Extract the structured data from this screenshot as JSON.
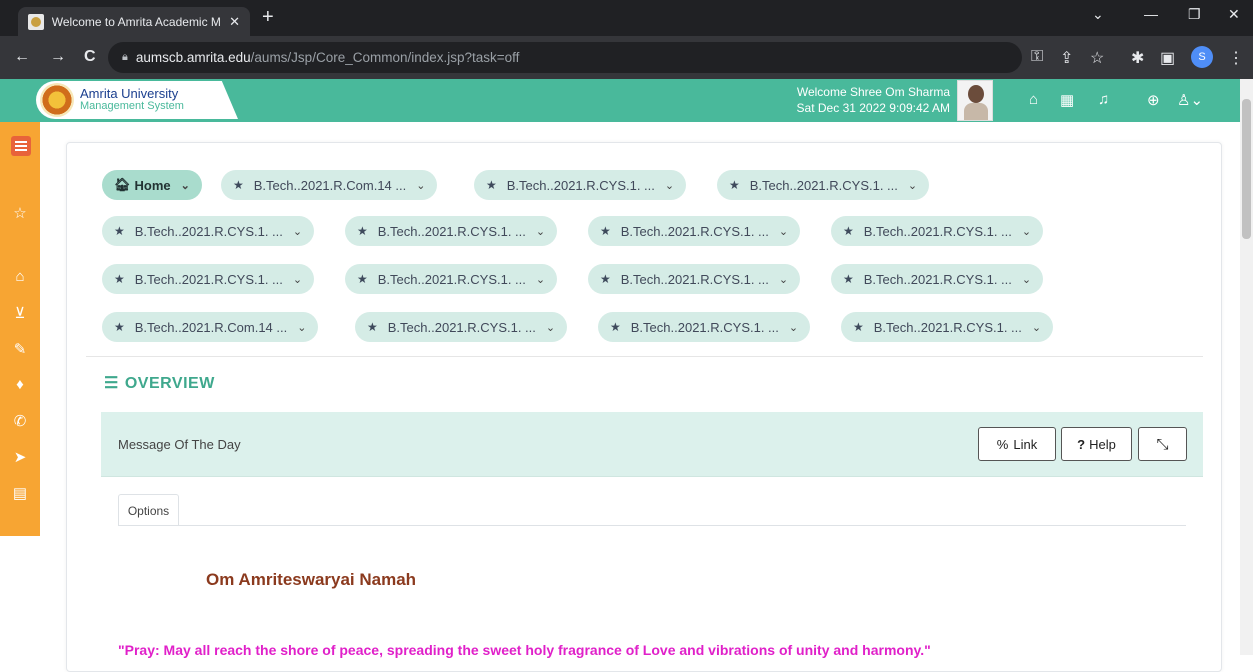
{
  "browser": {
    "tab_title": "Welcome to Amrita Academic M",
    "tab_close": "✕",
    "new_tab": "+",
    "url_host": "aumscb.amrita.edu",
    "url_path": "/aums/Jsp/Core_Common/index.jsp?task=off",
    "profile_initial": "S",
    "controls": {
      "dropdown": "⌄",
      "minimize": "—",
      "maximize": "❐",
      "close": "✕"
    },
    "nav": {
      "back": "←",
      "forward": "→",
      "reload": "C"
    },
    "toolbar_icons": {
      "key": "⚿",
      "share": "⇪",
      "bookmark": "☆",
      "extensions": "✱",
      "sidepanel": "▣",
      "menu": "⋮"
    }
  },
  "header": {
    "logo_line1": "Amrita University",
    "logo_line2": "Management System",
    "welcome_text": "Welcome Shree Om Sharma",
    "datetime": "Sat Dec 31 2022 9:09:42 AM",
    "icons": [
      "home-icon",
      "grid-icon",
      "bell-icon",
      "globe-icon",
      "user-icon"
    ],
    "icon_glyphs": {
      "home": "⌂",
      "grid": "▦",
      "bell": "♫",
      "globe": "⊕",
      "user": "♙⌄"
    }
  },
  "sidebar": {
    "glyphs": [
      "☆",
      "⌂",
      "⊻",
      "✎",
      "♦",
      "✆",
      "➤",
      "▤"
    ]
  },
  "breadcrumbs": {
    "home_label": "Home",
    "rows": [
      [
        "B.Tech..2021.R.Com.14 ...",
        "B.Tech..2021.R.CYS.1. ...",
        "B.Tech..2021.R.CYS.1. ..."
      ],
      [
        "B.Tech..2021.R.CYS.1. ...",
        "B.Tech..2021.R.CYS.1. ...",
        "B.Tech..2021.R.CYS.1. ...",
        "B.Tech..2021.R.CYS.1. ..."
      ],
      [
        "B.Tech..2021.R.CYS.1. ...",
        "B.Tech..2021.R.CYS.1. ...",
        "B.Tech..2021.R.CYS.1. ...",
        "B.Tech..2021.R.CYS.1. ..."
      ],
      [
        "B.Tech..2021.R.Com.14 ...",
        "B.Tech..2021.R.CYS.1. ...",
        "B.Tech..2021.R.CYS.1. ...",
        "B.Tech..2021.R.CYS.1. ..."
      ]
    ]
  },
  "overview": {
    "title": "OVERVIEW"
  },
  "panel": {
    "title": "Message Of The Day",
    "link_label": "Link",
    "help_label": "Help",
    "options_tab": "Options",
    "heading": "Om Amriteswaryai Namah",
    "quote": "\"Pray: May all reach the shore of peace, spreading the sweet holy fragrance of Love and vibrations of unity and harmony.\""
  },
  "colors": {
    "accent": "#49b99b",
    "sidebar": "#f7a533",
    "pill": "#d5ece6",
    "heading": "#8b3a1e",
    "quote": "#e020c9"
  }
}
